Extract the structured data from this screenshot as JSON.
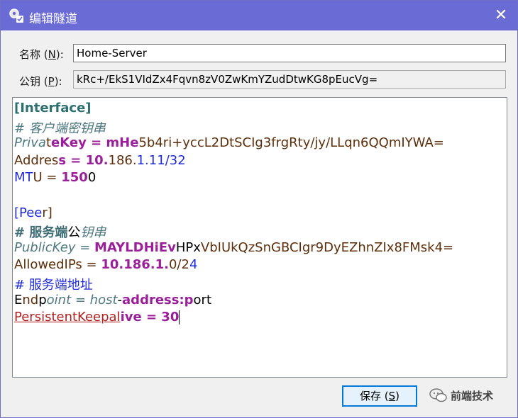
{
  "window": {
    "title": "编辑隧道",
    "close_glyph": "✕"
  },
  "form": {
    "name_label": "名称",
    "name_shortcut": "N",
    "name_value": "Home-Server",
    "pubkey_label": "公钥",
    "pubkey_shortcut": "P",
    "pubkey_value": "kRc+/EkS1VIdZx4Fqvn8zV0ZwKmYZudDtwKG8pEucVg="
  },
  "editor": {
    "lines": [
      {
        "segments": [
          {
            "text": "[Interface]",
            "style": "tealb"
          }
        ]
      },
      {
        "segments": [
          {
            "text": "# 客户端密钥串",
            "style": "cmt"
          }
        ]
      },
      {
        "segments": [
          {
            "text": "Priva",
            "style": "cmt"
          },
          {
            "text": "t",
            "style": "brown"
          },
          {
            "text": "eKey = mHe",
            "style": "purple"
          },
          {
            "text": "5b4",
            "style": "brown"
          },
          {
            "text": "ri+yccL2DtSCIg3frgRty/jy/LLqn6QQmIYWA=",
            "style": "brown"
          }
        ]
      },
      {
        "segments": [
          {
            "text": "Addres",
            "style": "brown"
          },
          {
            "text": "s = 10.",
            "style": "purple"
          },
          {
            "text": "186.",
            "style": "brown"
          },
          {
            "text": "1.11/32",
            "style": "blue"
          }
        ]
      },
      {
        "segments": [
          {
            "text": "MT",
            "style": "blue"
          },
          {
            "text": "U = ",
            "style": "brown"
          },
          {
            "text": "150",
            "style": "purple"
          },
          {
            "text": "0",
            "style": "bk"
          }
        ]
      },
      {
        "segments": [
          {
            "text": " ",
            "style": "bk"
          }
        ]
      },
      {
        "segments": [
          {
            "text": "[Pee",
            "style": "blue"
          },
          {
            "text": "r]",
            "style": "brown"
          }
        ]
      },
      {
        "segments": [
          {
            "text": "# 服务端",
            "style": "cmtb"
          },
          {
            "text": "公",
            "style": "bk"
          },
          {
            "text": "钥串",
            "style": "cmt"
          }
        ]
      },
      {
        "segments": [
          {
            "text": "PublicKey = ",
            "style": "cmt"
          },
          {
            "text": "MAYLDHiEv",
            "style": "purple"
          },
          {
            "text": "HPx",
            "style": "bk"
          },
          {
            "text": "VbIUkQzSnGBCIgr9DyEZhnZIx8FMsk4=",
            "style": "brown"
          }
        ]
      },
      {
        "segments": [
          {
            "text": "AllowedIPs = ",
            "style": "brown"
          },
          {
            "text": "10.186.1.",
            "style": "purple"
          },
          {
            "text": "0/2",
            "style": "brown"
          },
          {
            "text": "4",
            "style": "blue"
          }
        ]
      },
      {
        "segments": [
          {
            "text": "# 服务端地址",
            "style": "blue"
          }
        ]
      },
      {
        "segments": [
          {
            "text": "E",
            "style": "bk"
          },
          {
            "text": "nd",
            "style": "brown"
          },
          {
            "text": "p",
            "style": "bk"
          },
          {
            "text": "oint = host",
            "style": "cmt"
          },
          {
            "text": "-",
            "style": "bk"
          },
          {
            "text": "address:p",
            "style": "purple"
          },
          {
            "text": "ort",
            "style": "bk"
          }
        ]
      },
      {
        "segments": [
          {
            "text": "PersistentKeepal",
            "style": "red"
          },
          {
            "text": "ive = 30",
            "style": "purple"
          }
        ]
      }
    ]
  },
  "buttons": {
    "save_label": "保存",
    "save_shortcut": "S"
  },
  "watermark": {
    "text": "前端技术"
  },
  "colors": {
    "titlebar": "#6b6bd6",
    "focus": "#0078d7"
  }
}
